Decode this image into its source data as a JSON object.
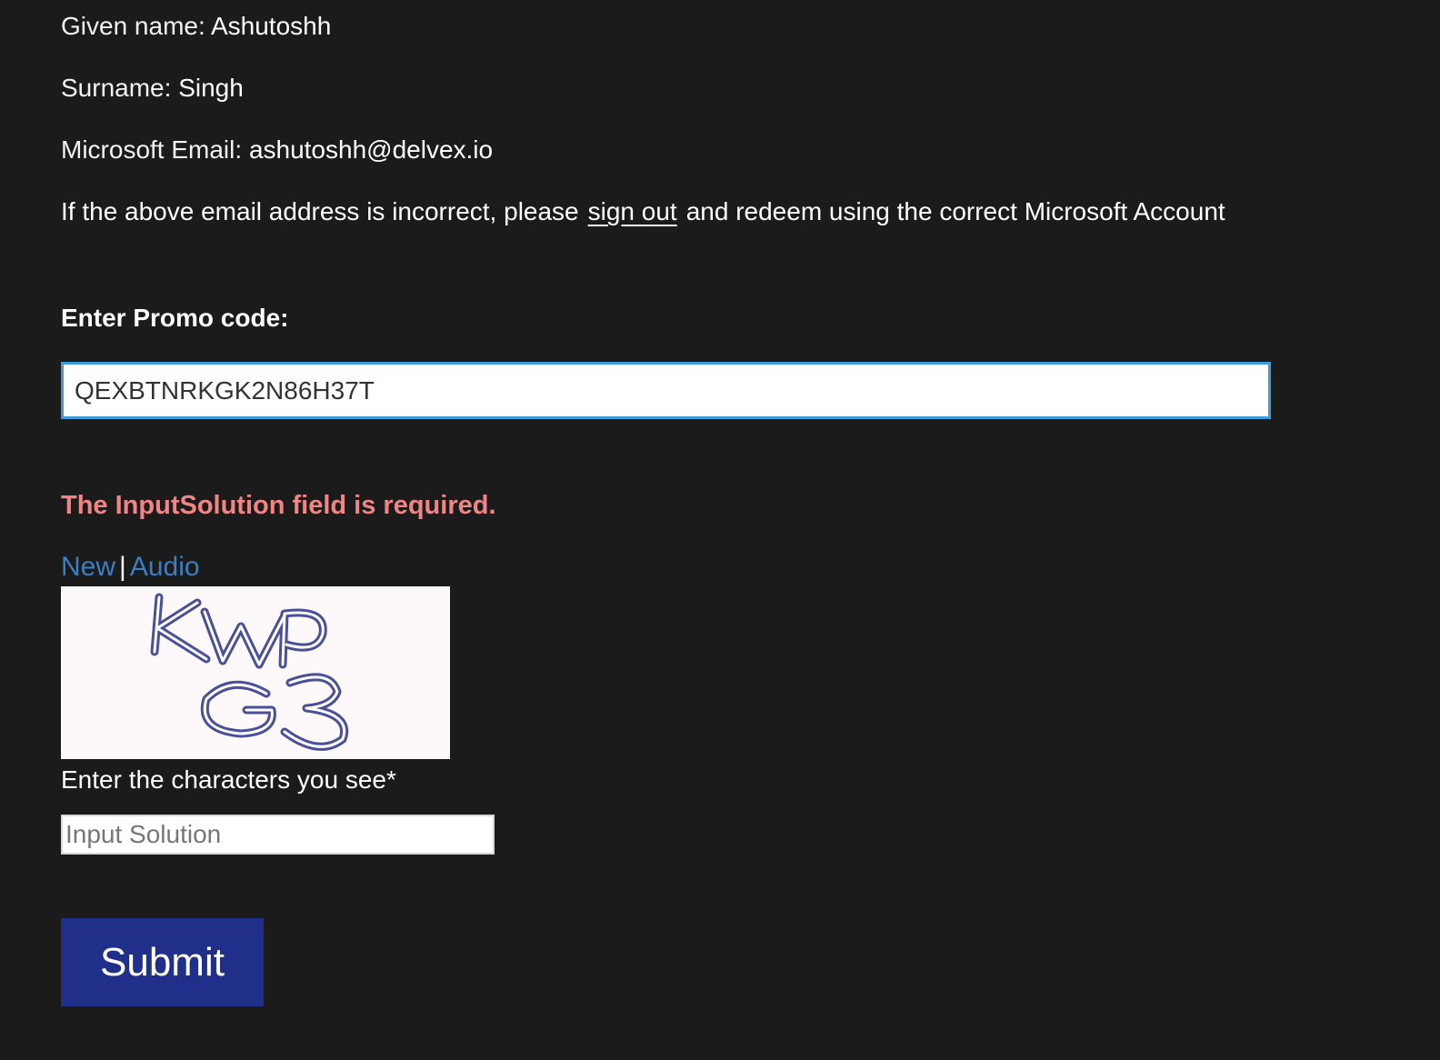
{
  "profile": {
    "given_name_label": "Given name:",
    "given_name_value": "Ashutoshh",
    "surname_label": "Surname:",
    "surname_value": "Singh",
    "email_label": "Microsoft Email:",
    "email_value": "ashutoshh@delvex.io"
  },
  "notice": {
    "before": "If the above email address is incorrect, please",
    "link": "sign out",
    "after": "and redeem using the correct Microsoft Account"
  },
  "promo": {
    "label": "Enter Promo code:",
    "value": "QEXBTNRKGK2N86H37T"
  },
  "error": {
    "message": "The InputSolution field is required."
  },
  "captcha": {
    "new_label": "New",
    "separator": "|",
    "audio_label": "Audio",
    "image_text": "KWP G3",
    "prompt": "Enter the characters you see*",
    "input_placeholder": "Input Solution",
    "input_value": ""
  },
  "submit": {
    "label": "Submit"
  },
  "colors": {
    "background": "#1b1b1b",
    "error": "#f08585",
    "link": "#3a7fc4",
    "focus_border": "#3d9be0",
    "submit_bg": "#20308a"
  }
}
